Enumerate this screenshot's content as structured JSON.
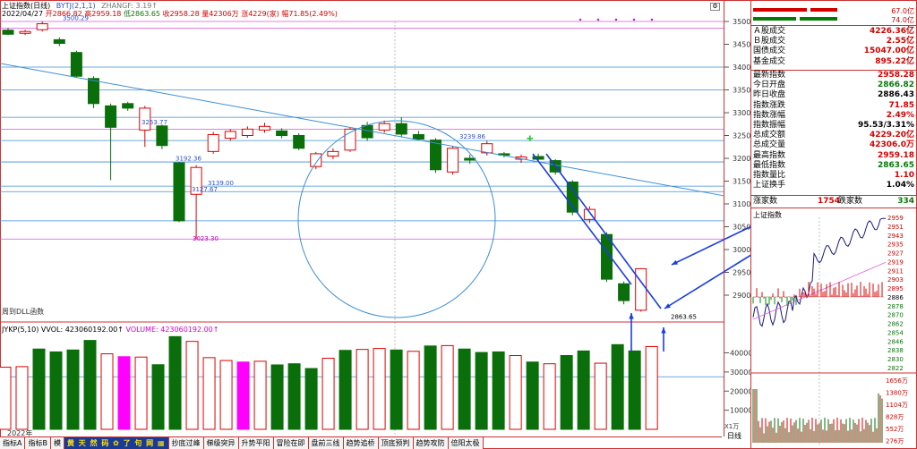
{
  "header": {
    "title": "上证指数(日线)",
    "indicator": "BYTJ(2,1,1)",
    "indicator_aux": "ZHANGF: 3.19↑",
    "date": "2022/04/27",
    "open": "开2866.82",
    "high": "高2959.18",
    "low": "低2863.65",
    "close": "收2958.28",
    "volume": "量42306万",
    "change": "涨4229(家)",
    "pct": "幅71.85(2.49%)"
  },
  "main_chart": {
    "price_axis": [
      "3500",
      "3450",
      "3400",
      "3350",
      "3300",
      "3250",
      "3200",
      "3150",
      "3100",
      "3050",
      "3000",
      "2950",
      "2900"
    ],
    "annotations": {
      "a1": "3500.29",
      "a2": "3253.77",
      "a3": "3239.86",
      "a4": "3192.36",
      "a5": "3139.00",
      "a6": "3127.67",
      "a7": "3023.30",
      "low": "2863.65"
    },
    "dll_label": "周到DLL函数",
    "candles": [
      {
        "o": 3481,
        "c": 3472,
        "h": 3486,
        "l": 3470
      },
      {
        "o": 3474,
        "c": 3478,
        "h": 3482,
        "l": 3470
      },
      {
        "o": 3482,
        "c": 3495,
        "h": 3500.29,
        "l": 3478
      },
      {
        "o": 3460,
        "c": 3452,
        "h": 3465,
        "l": 3446
      },
      {
        "o": 3432,
        "c": 3380,
        "h": 3436,
        "l": 3376
      },
      {
        "o": 3375,
        "c": 3320,
        "h": 3380,
        "l": 3310
      },
      {
        "o": 3315,
        "c": 3268,
        "h": 3320,
        "l": 3152
      },
      {
        "o": 3320,
        "c": 3310,
        "h": 3324,
        "l": 3304
      },
      {
        "o": 3262,
        "c": 3310,
        "h": 3315,
        "l": 3225
      },
      {
        "o": 3271,
        "c": 3228,
        "h": 3274,
        "l": 3220
      },
      {
        "o": 3190,
        "c": 3063,
        "h": 3192.36,
        "l": 3060
      },
      {
        "o": 3121,
        "c": 3180,
        "h": 3185,
        "l": 3023.3
      },
      {
        "o": 3215,
        "c": 3252,
        "h": 3258,
        "l": 3210
      },
      {
        "o": 3244,
        "c": 3259,
        "h": 3264,
        "l": 3238
      },
      {
        "o": 3250,
        "c": 3264,
        "h": 3270,
        "l": 3245
      },
      {
        "o": 3262,
        "c": 3270,
        "h": 3278,
        "l": 3256
      },
      {
        "o": 3260,
        "c": 3250,
        "h": 3266,
        "l": 3244
      },
      {
        "o": 3250,
        "c": 3222,
        "h": 3255,
        "l": 3218
      },
      {
        "o": 3182,
        "c": 3210,
        "h": 3214,
        "l": 3176
      },
      {
        "o": 3205,
        "c": 3215,
        "h": 3222,
        "l": 3198
      },
      {
        "o": 3218,
        "c": 3264,
        "h": 3268,
        "l": 3214
      },
      {
        "o": 3272,
        "c": 3245,
        "h": 3280,
        "l": 3238
      },
      {
        "o": 3262,
        "c": 3276,
        "h": 3283,
        "l": 3256
      },
      {
        "o": 3276,
        "c": 3253,
        "h": 3290,
        "l": 3246
      },
      {
        "o": 3252,
        "c": 3242,
        "h": 3260,
        "l": 3239.86
      },
      {
        "o": 3240,
        "c": 3175,
        "h": 3244,
        "l": 3168
      },
      {
        "o": 3170,
        "c": 3222,
        "h": 3226,
        "l": 3164
      },
      {
        "o": 3200,
        "c": 3196,
        "h": 3208,
        "l": 3188
      },
      {
        "o": 3212,
        "c": 3232,
        "h": 3238,
        "l": 3206
      },
      {
        "o": 3210,
        "c": 3207,
        "h": 3214,
        "l": 3202
      },
      {
        "o": 3198,
        "c": 3203,
        "h": 3208,
        "l": 3190
      },
      {
        "o": 3204,
        "c": 3198,
        "h": 3210,
        "l": 3192
      },
      {
        "o": 3195,
        "c": 3170,
        "h": 3198,
        "l": 3164
      },
      {
        "o": 3148,
        "c": 3082,
        "h": 3152,
        "l": 3075
      },
      {
        "o": 3066,
        "c": 3088,
        "h": 3095,
        "l": 3058
      },
      {
        "o": 3033,
        "c": 2935,
        "h": 3038,
        "l": 2929
      },
      {
        "o": 2925,
        "c": 2888,
        "h": 2930,
        "l": 2880
      },
      {
        "o": 2867,
        "c": 2958,
        "h": 2959.18,
        "l": 2863.65
      }
    ]
  },
  "volume_chart": {
    "label": "JYKP(5,10)",
    "vvol": "VVOL: 423060192.00↑",
    "volume": "VOLUME: 423060192.00↑",
    "axis": [
      "40000",
      "30000",
      "20000",
      "10000"
    ],
    "x1k": "X1万",
    "bars": [
      {
        "v": 32500,
        "d": "u"
      },
      {
        "v": 32800,
        "d": "u"
      },
      {
        "v": 42000,
        "d": "d"
      },
      {
        "v": 40500,
        "d": "d"
      },
      {
        "v": 41500,
        "d": "d"
      },
      {
        "v": 46500,
        "d": "d"
      },
      {
        "v": 39500,
        "d": "u"
      },
      {
        "v": 38000,
        "d": "m"
      },
      {
        "v": 37800,
        "d": "u"
      },
      {
        "v": 33800,
        "d": "d"
      },
      {
        "v": 48500,
        "d": "d"
      },
      {
        "v": 46000,
        "d": "u"
      },
      {
        "v": 37500,
        "d": "u"
      },
      {
        "v": 36000,
        "d": "u"
      },
      {
        "v": 35200,
        "d": "m"
      },
      {
        "v": 35600,
        "d": "u"
      },
      {
        "v": 33700,
        "d": "d"
      },
      {
        "v": 34300,
        "d": "d"
      },
      {
        "v": 31800,
        "d": "d"
      },
      {
        "v": 37200,
        "d": "u"
      },
      {
        "v": 41300,
        "d": "d"
      },
      {
        "v": 41800,
        "d": "u"
      },
      {
        "v": 42300,
        "d": "u"
      },
      {
        "v": 41500,
        "d": "d"
      },
      {
        "v": 40800,
        "d": "u"
      },
      {
        "v": 43600,
        "d": "d"
      },
      {
        "v": 43800,
        "d": "u"
      },
      {
        "v": 42000,
        "d": "d"
      },
      {
        "v": 40200,
        "d": "d"
      },
      {
        "v": 40500,
        "d": "d"
      },
      {
        "v": 38600,
        "d": "u"
      },
      {
        "v": 35200,
        "d": "d"
      },
      {
        "v": 34300,
        "d": "u"
      },
      {
        "v": 38600,
        "d": "d"
      },
      {
        "v": 41000,
        "d": "d"
      },
      {
        "v": 34600,
        "d": "u"
      },
      {
        "v": 44300,
        "d": "d"
      },
      {
        "v": 41000,
        "d": "d"
      },
      {
        "v": 43300,
        "d": "u"
      }
    ]
  },
  "tabs": [
    "指标A",
    "指标B",
    "模",
    "黄 天 然 码 ✿ 了 句 网 ▦",
    "抄底过峰",
    "梯级突异",
    "升势平阳",
    "冒险在即",
    "盘前三线",
    "趋势追桥",
    "顶底预判",
    "趋势攻防",
    "倍阳太极"
  ],
  "year_label": "2022年",
  "bottom_right": "日线",
  "right_panel": {
    "top_values": [
      "67.0亿",
      "74.0亿"
    ],
    "stats_a": [
      {
        "k": "Ａ股成交",
        "v": "4226.36亿",
        "c": "red"
      },
      {
        "k": "Ｂ股成交",
        "v": "2.55亿",
        "c": "red"
      },
      {
        "k": "国债成交",
        "v": "15047.00亿",
        "c": "red"
      },
      {
        "k": "基金成交",
        "v": "895.22亿",
        "c": "red"
      }
    ],
    "stats_b": [
      {
        "k": "最新指数",
        "v": "2958.28",
        "c": "red"
      },
      {
        "k": "今日开盘",
        "v": "2866.82",
        "c": "green"
      },
      {
        "k": "昨日收盘",
        "v": "2886.43",
        "c": "black"
      },
      {
        "k": "指数涨跌",
        "v": "71.85",
        "c": "red"
      },
      {
        "k": "指数涨幅",
        "v": "2.49%",
        "c": "red"
      },
      {
        "k": "指数振幅",
        "v": "95.53/3.31%",
        "c": "black"
      },
      {
        "k": "总成交额",
        "v": "4229.20亿",
        "c": "red"
      },
      {
        "k": "总成交量",
        "v": "42306.0万",
        "c": "red"
      },
      {
        "k": "最高指数",
        "v": "2959.18",
        "c": "red"
      },
      {
        "k": "最低指数",
        "v": "2863.65",
        "c": "green"
      },
      {
        "k": "指数量比",
        "v": "1.10",
        "c": "red"
      },
      {
        "k": "上证换手",
        "v": "1.04%",
        "c": "black"
      }
    ],
    "rise_label": "涨家数",
    "rise_value": "1754",
    "fall_label": "跌家数",
    "fall_value": "334",
    "minichart_title": "上证指数",
    "minichart_axis": [
      "2959",
      "2951",
      "2943",
      "2935",
      "2927",
      "2919",
      "2911",
      "2903",
      "2895",
      "2886",
      "2878",
      "2870",
      "2862",
      "2854",
      "2846",
      "2838",
      "2830",
      "2822"
    ],
    "minivol_axis": [
      "1656万",
      "1380万",
      "1104万",
      "828万",
      "552万",
      "276万"
    ]
  },
  "colors": {
    "up": "#e00000",
    "down": "#0a6e0a",
    "magenta": "#ff00ff",
    "blue_line": "#1a3ee0",
    "trend": "#3d8fd6"
  }
}
